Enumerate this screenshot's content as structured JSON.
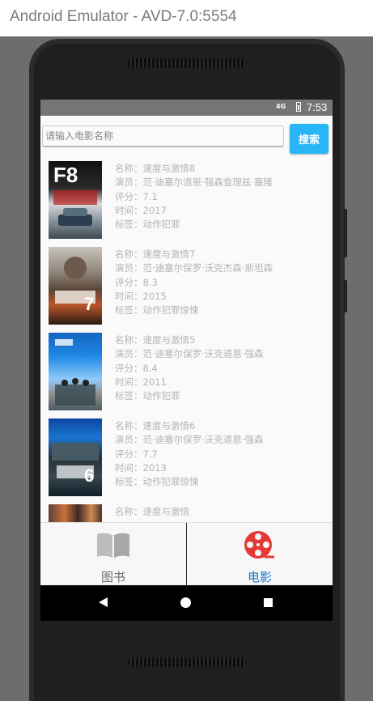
{
  "window": {
    "title": "Android Emulator - AVD-7.0:5554"
  },
  "status_bar": {
    "network": "4G",
    "time": "7:53"
  },
  "search": {
    "placeholder": "请输入电影名称",
    "button_label": "搜索"
  },
  "movies": [
    {
      "name": "名称：速度与激情8",
      "actors": "演员：范·迪塞尔道恩·强森查理兹·塞隆",
      "rating": "评分：7.1",
      "time": "时间：2017",
      "tags": "标签：动作犯罪",
      "poster_text": "F8"
    },
    {
      "name": "名称：速度与激情7",
      "actors": "演员：范·迪塞尔保罗·沃克杰森·斯坦森",
      "rating": "评分：8.3",
      "time": "时间：2015",
      "tags": "标签：动作犯罪惊悚",
      "poster_text": "7"
    },
    {
      "name": "名称：速度与激情5",
      "actors": "演员：范·迪塞尔保罗·沃克道恩·强森",
      "rating": "评分：8.4",
      "time": "时间：2011",
      "tags": "标签：动作犯罪",
      "poster_text": ""
    },
    {
      "name": "名称：速度与激情6",
      "actors": "演员：范·迪塞尔保罗·沃克道恩·强森",
      "rating": "评分：7.7",
      "time": "时间：2013",
      "tags": "标签：动作犯罪惊悚",
      "poster_text": "6"
    },
    {
      "name": "名称：速度与激情",
      "actors": "",
      "rating": "",
      "time": "",
      "tags": "",
      "poster_text": ""
    }
  ],
  "tabs": [
    {
      "label": "图书",
      "icon": "book-icon",
      "active": false
    },
    {
      "label": "电影",
      "icon": "film-reel-icon",
      "active": true
    }
  ],
  "colors": {
    "accent": "#29b6f6",
    "active_tab": "#1976d2",
    "film_icon": "#e53935"
  }
}
